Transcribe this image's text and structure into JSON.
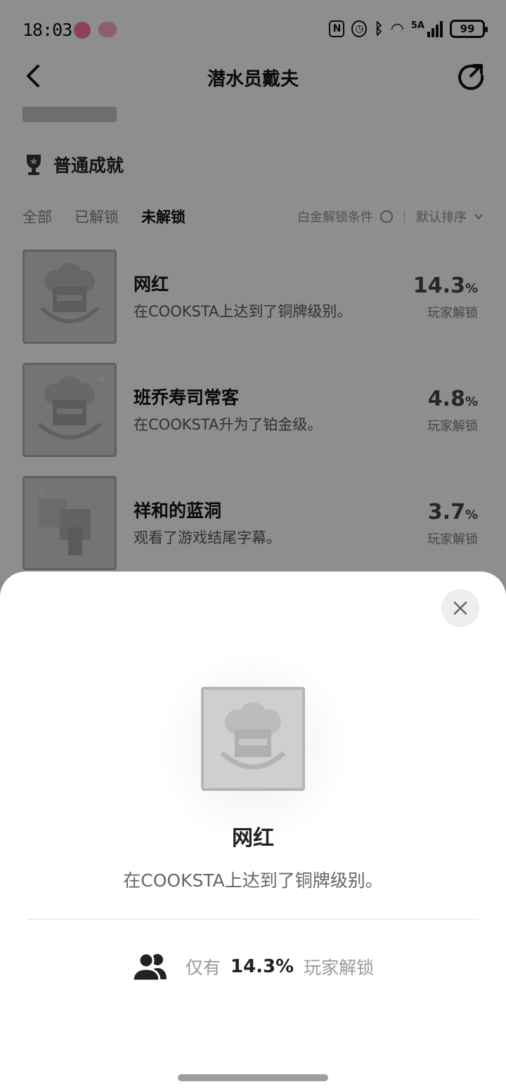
{
  "status_bar": {
    "time": "18:03",
    "icons": [
      "nfc-icon",
      "alarm-icon",
      "bluetooth-icon",
      "wifi-icon",
      "signal-icon"
    ],
    "network": "5A",
    "battery": "99"
  },
  "header": {
    "title": "潜水员戴夫"
  },
  "section": {
    "title": "普通成就"
  },
  "filters": {
    "tabs": [
      "全部",
      "已解锁",
      "未解锁"
    ],
    "active_tab": "未解锁",
    "platinum_condition": "白金解锁条件",
    "sort": "默认排序"
  },
  "achievements": [
    {
      "name": "网红",
      "desc": "在COOKSTA上达到了铜牌级别。",
      "pct": "14.3",
      "pct_unit": "%",
      "pct_label": "玩家解锁"
    },
    {
      "name": "班乔寿司常客",
      "desc": "在COOKSTA升为了铂金级。",
      "pct": "4.8",
      "pct_unit": "%",
      "pct_label": "玩家解锁"
    },
    {
      "name": "祥和的蓝洞",
      "desc": "观看了游戏结尾字幕。",
      "pct": "3.7",
      "pct_unit": "%",
      "pct_label": "玩家解锁"
    }
  ],
  "sheet": {
    "name": "网红",
    "desc": "在COOKSTA上达到了铜牌级别。",
    "stat_prefix": "仅有",
    "stat_pct": "14.3%",
    "stat_suffix": "玩家解锁"
  },
  "colors": {
    "scrim": "#000000",
    "sheet_bg": "#ffffff",
    "badge_gray": "#cfcfcf"
  }
}
